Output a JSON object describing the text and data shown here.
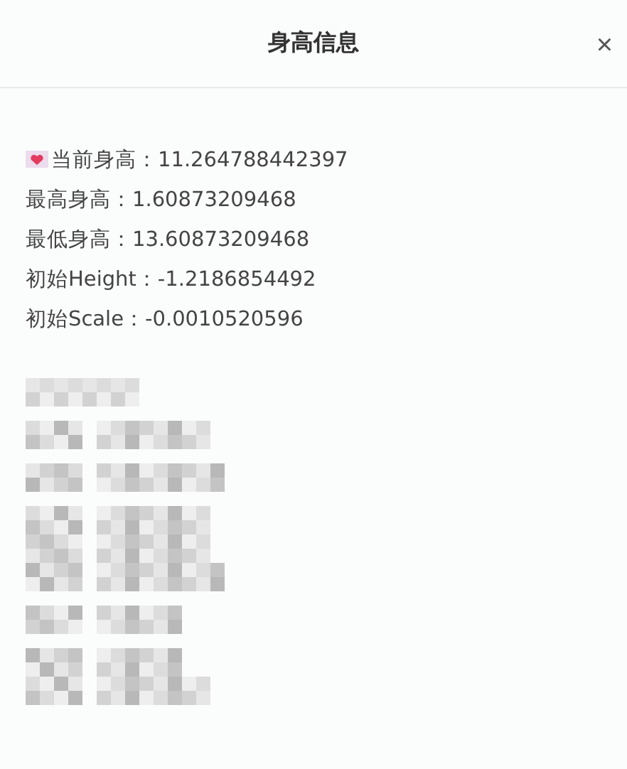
{
  "dialog": {
    "title": "身高信息",
    "close": "×"
  },
  "info_lines": [
    {
      "kind": "icon",
      "text": "当前身高：11.264788442397"
    },
    {
      "kind": "plain",
      "text": "最高身高：1.60873209468"
    },
    {
      "kind": "plain",
      "text": "最低身高：13.60873209468"
    },
    {
      "kind": "plain",
      "text": "初始Height：-1.2186854492"
    },
    {
      "kind": "plain",
      "text": "初始Scale：-0.0010520596"
    }
  ]
}
